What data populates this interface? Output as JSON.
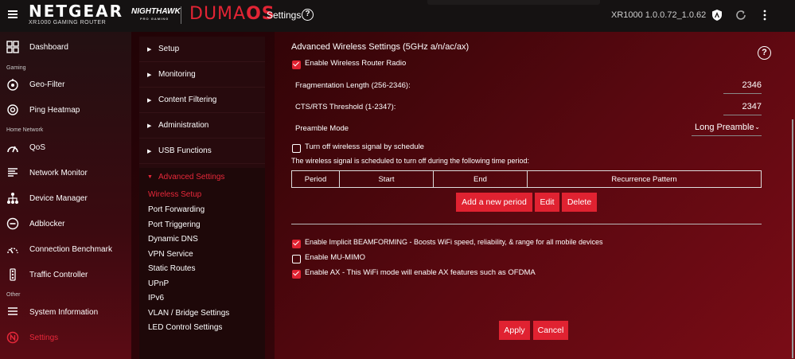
{
  "header": {
    "brand": "NETGEAR",
    "brand_sub": "XR1000 GAMING ROUTER",
    "nighthawk": "NIGHTHAWK",
    "nighthawk_sub": "PRO GAMING",
    "os_name_a": "DUMA",
    "os_name_b": "OS",
    "page_title": "Settings",
    "help": "?",
    "version": "XR1000 1.0.0.72_1.0.62"
  },
  "sidebar": {
    "dashboard": "Dashboard",
    "section_gaming": "Gaming",
    "geo_filter": "Geo-Filter",
    "ping_heatmap": "Ping Heatmap",
    "section_home": "Home Network",
    "qos": "QoS",
    "network_monitor": "Network Monitor",
    "device_manager": "Device Manager",
    "adblocker": "Adblocker",
    "connection_benchmark": "Connection Benchmark",
    "traffic_controller": "Traffic Controller",
    "section_other": "Other",
    "system_information": "System Information",
    "settings": "Settings"
  },
  "menu": {
    "setup": "Setup",
    "monitoring": "Monitoring",
    "content_filtering": "Content Filtering",
    "administration": "Administration",
    "usb_functions": "USB Functions",
    "advanced_settings": "Advanced Settings",
    "sub": {
      "wireless_setup": "Wireless Setup",
      "port_forwarding": "Port Forwarding",
      "port_triggering": "Port Triggering",
      "dynamic_dns": "Dynamic DNS",
      "vpn_service": "VPN Service",
      "static_routes": "Static Routes",
      "upnp": "UPnP",
      "ipv6": "IPv6",
      "vlan_bridge": "VLAN / Bridge Settings",
      "led_control": "LED Control Settings"
    }
  },
  "content": {
    "heading": "Advanced Wireless Settings (5GHz a/n/ac/ax)",
    "help": "?",
    "enable_radio": "Enable Wireless Router Radio",
    "frag_label": "Fragmentation Length (256-2346):",
    "frag_value": "2346",
    "cts_label": "CTS/RTS Threshold (1-2347):",
    "cts_value": "2347",
    "preamble_label": "Preamble Mode",
    "preamble_value": "Long Preamble",
    "schedule_label": "Turn off wireless signal by schedule",
    "schedule_desc": "The wireless signal is scheduled to turn off during the following time period:",
    "table_headers": {
      "period": "Period",
      "start": "Start",
      "end": "End",
      "recurrence": "Recurrence Pattern"
    },
    "add_period": "Add a new period",
    "edit": "Edit",
    "delete": "Delete",
    "beamforming": "Enable Implicit BEAMFORMING - Boosts WiFi speed, reliability, & range for all mobile devices",
    "mu_mimo": "Enable MU-MIMO",
    "ax": "Enable AX - This WiFi mode will enable AX features such as OFDMA",
    "apply": "Apply",
    "cancel": "Cancel"
  },
  "colors": {
    "accent": "#e02231"
  }
}
